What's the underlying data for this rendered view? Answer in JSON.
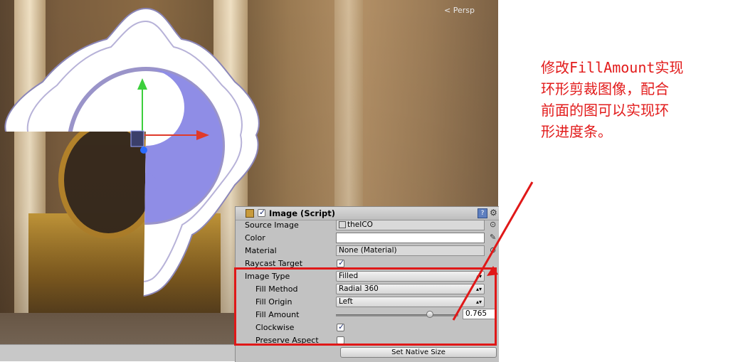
{
  "scene": {
    "persp_label": "Persp"
  },
  "inspector": {
    "component": {
      "title": "Image (Script)",
      "enabled": true
    },
    "fields": {
      "source_image": {
        "label": "Source Image",
        "value": "theICO"
      },
      "color": {
        "label": "Color",
        "value": "#ffffff"
      },
      "material": {
        "label": "Material",
        "value": "None (Material)"
      },
      "raycast_target": {
        "label": "Raycast Target",
        "checked": true
      },
      "image_type": {
        "label": "Image Type",
        "value": "Filled"
      },
      "fill_method": {
        "label": "Fill Method",
        "value": "Radial 360"
      },
      "fill_origin": {
        "label": "Fill Origin",
        "value": "Left"
      },
      "fill_amount": {
        "label": "Fill Amount",
        "value": "0.765",
        "fraction": 0.765
      },
      "clockwise": {
        "label": "Clockwise",
        "checked": true
      },
      "preserve_aspect": {
        "label": "Preserve Aspect",
        "checked": false
      }
    },
    "set_native_size_label": "Set Native Size"
  },
  "annotation": {
    "lines": [
      "修改FillAmount实现",
      "环形剪裁图像，配合",
      "前面的图可以实现环",
      "形进度条。"
    ],
    "color": "#e21b1b"
  },
  "icons": {
    "gear": "gear-icon",
    "help": "help-icon",
    "color_picker": "eyedropper-icon",
    "object_picker": "target-icon"
  }
}
